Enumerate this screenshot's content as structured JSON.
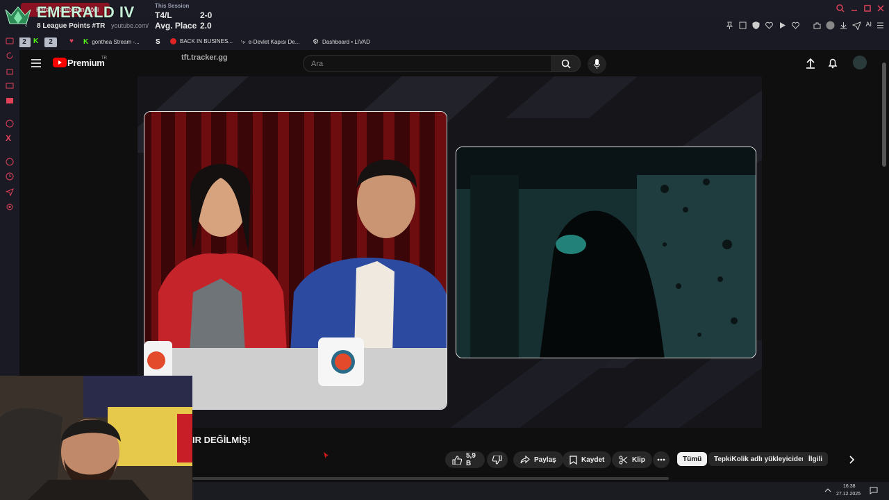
{
  "overlay": {
    "rank": "EMERALD IV",
    "league_points": "8 League Points #TR",
    "session_title": "This Session",
    "stats": [
      {
        "label": "T4/L",
        "value": "2-0"
      },
      {
        "label": "Avg. Place",
        "value": "2.0"
      }
    ],
    "tracker": "tft.tracker.gg"
  },
  "browser": {
    "active_tab_label": "Kafanı Yapıp Ban Yönl",
    "address": "youtube.com/",
    "ai_label": "AI",
    "profile_counts": [
      "2",
      "2"
    ],
    "bookmarks": [
      {
        "label": "gonthea Stream -...",
        "icon": "kick-icon",
        "color": "#53fc18"
      },
      {
        "label": "",
        "icon": "s-icon",
        "color": "#ffffff"
      },
      {
        "label": "BACK IN BUSINES...",
        "icon": "record-icon",
        "color": "#e02424"
      },
      {
        "label": "e-Devlet Kapısı De...",
        "icon": "link-icon",
        "color": "#e2e2e2"
      },
      {
        "label": "Dashboard • LIVAD",
        "icon": "dashboard-icon",
        "color": "#e2e2e2"
      }
    ]
  },
  "youtube": {
    "logo_text": "Premium",
    "logo_region": "TR",
    "search_placeholder": "Ara",
    "video_title": "IR DEĞİLMİŞ!",
    "likes": "5,9 B",
    "share_label": "Paylaş",
    "save_label": "Kaydet",
    "clip_label": "Klip",
    "chips": [
      "Tümü",
      "TepkiKolik adlı yükleyiciden",
      "İlgili"
    ]
  },
  "taskbar": {
    "time": "16:38",
    "date": "27.12.2025"
  },
  "colors": {
    "accent": "#ff0000",
    "overlay_green": "#c7f0d8",
    "tab_active": "#8a1222"
  }
}
